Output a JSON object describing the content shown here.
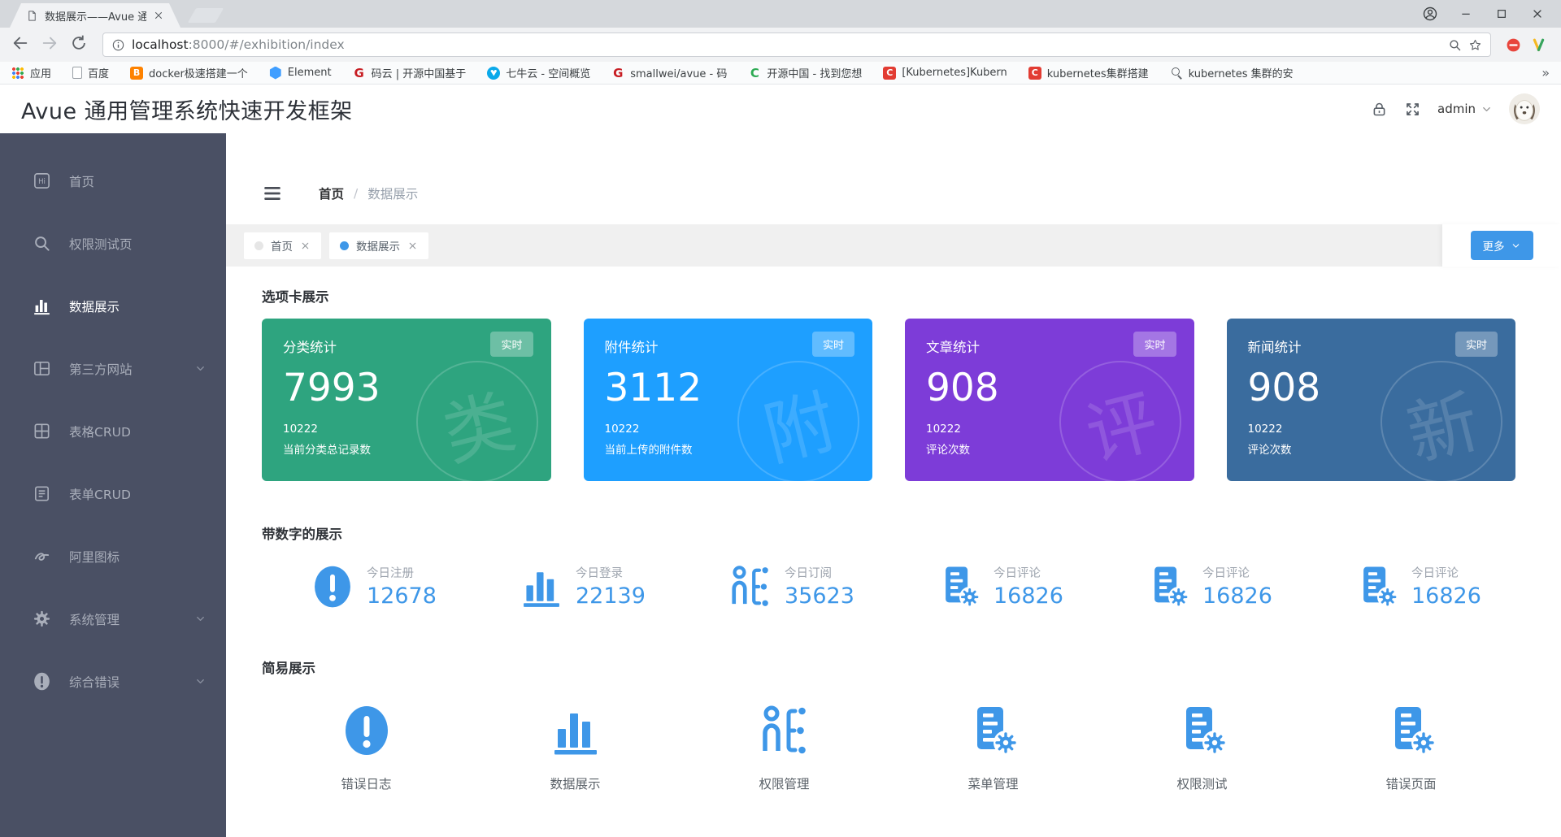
{
  "browser": {
    "tab_title": "数据展示——Avue 通用",
    "url_host": "localhost",
    "url_rest": ":8000/#/exhibition/index",
    "bookmarks": [
      {
        "label": "应用",
        "icon": "apps-grid-icon"
      },
      {
        "label": "百度",
        "icon": "page-outline-icon"
      },
      {
        "label": "docker极速搭建一个",
        "icon": "blogger-icon"
      },
      {
        "label": "Element",
        "icon": "element-icon"
      },
      {
        "label": "码云 | 开源中国基于",
        "icon": "gitee-icon"
      },
      {
        "label": "七牛云 - 空间概览",
        "icon": "qiniu-icon"
      },
      {
        "label": "smallwei/avue - 码",
        "icon": "gitee-icon"
      },
      {
        "label": "开源中国 - 找到您想",
        "icon": "oschina-icon"
      },
      {
        "label": "[Kubernetes]Kubern",
        "icon": "csdn-icon"
      },
      {
        "label": "kubernetes集群搭建",
        "icon": "csdn-icon"
      },
      {
        "label": "kubernetes 集群的安",
        "icon": "person-search-icon"
      }
    ],
    "bookmarks_overflow": "»"
  },
  "header": {
    "title": "Avue 通用管理系统快速开发框架",
    "user": "admin"
  },
  "sidebar": {
    "items": [
      {
        "label": "首页",
        "icon": "hi-icon"
      },
      {
        "label": "权限测试页",
        "icon": "search-icon"
      },
      {
        "label": "数据展示",
        "icon": "bar-chart-icon",
        "active": true
      },
      {
        "label": "第三方网站",
        "icon": "grid-layout-icon",
        "expandable": true
      },
      {
        "label": "表格CRUD",
        "icon": "table-grid-icon"
      },
      {
        "label": "表单CRUD",
        "icon": "form-doc-icon"
      },
      {
        "label": "阿里图标",
        "icon": "curve-icon"
      },
      {
        "label": "系统管理",
        "icon": "gear-icon",
        "expandable": true
      },
      {
        "label": "综合错误",
        "icon": "exclamation-circle-icon",
        "expandable": true
      }
    ]
  },
  "breadcrumb": {
    "home": "首页",
    "separator": "/",
    "current": "数据展示"
  },
  "tags": {
    "items": [
      {
        "label": "首页",
        "active": false
      },
      {
        "label": "数据展示",
        "active": true
      }
    ],
    "more_label": "更多"
  },
  "sections": {
    "cards": {
      "title": "选项卡展示",
      "items": [
        {
          "title": "分类统计",
          "badge": "实时",
          "value": "7993",
          "sub_value": "10222",
          "subtitle": "当前分类总记录数",
          "watermark": "类",
          "color": "#2ea47f"
        },
        {
          "title": "附件统计",
          "badge": "实时",
          "value": "3112",
          "sub_value": "10222",
          "subtitle": "当前上传的附件数",
          "watermark": "附",
          "color": "#1e9fff"
        },
        {
          "title": "文章统计",
          "badge": "实时",
          "value": "908",
          "sub_value": "10222",
          "subtitle": "评论次数",
          "watermark": "评",
          "color": "#7d3cd8"
        },
        {
          "title": "新闻统计",
          "badge": "实时",
          "value": "908",
          "sub_value": "10222",
          "subtitle": "评论次数",
          "watermark": "新",
          "color": "#3a6c9e"
        }
      ]
    },
    "stats": {
      "title": "带数字的展示",
      "items": [
        {
          "label": "今日注册",
          "value": "12678",
          "icon": "exclamation-circle-icon"
        },
        {
          "label": "今日登录",
          "value": "22139",
          "icon": "bar-chart-icon"
        },
        {
          "label": "今日订阅",
          "value": "35623",
          "icon": "person-list-icon"
        },
        {
          "label": "今日评论",
          "value": "16826",
          "icon": "doc-gear-icon"
        },
        {
          "label": "今日评论",
          "value": "16826",
          "icon": "doc-gear-icon"
        },
        {
          "label": "今日评论",
          "value": "16826",
          "icon": "doc-gear-icon"
        }
      ]
    },
    "simple": {
      "title": "简易展示",
      "items": [
        {
          "label": "错误日志",
          "icon": "exclamation-circle-icon"
        },
        {
          "label": "数据展示",
          "icon": "bar-chart-icon"
        },
        {
          "label": "权限管理",
          "icon": "person-list-icon"
        },
        {
          "label": "菜单管理",
          "icon": "doc-gear-icon"
        },
        {
          "label": "权限测试",
          "icon": "doc-gear-icon"
        },
        {
          "label": "错误页面",
          "icon": "doc-gear-icon"
        }
      ]
    }
  },
  "colors": {
    "accent": "#3e97e8",
    "sidebar_bg": "#4a5064"
  }
}
